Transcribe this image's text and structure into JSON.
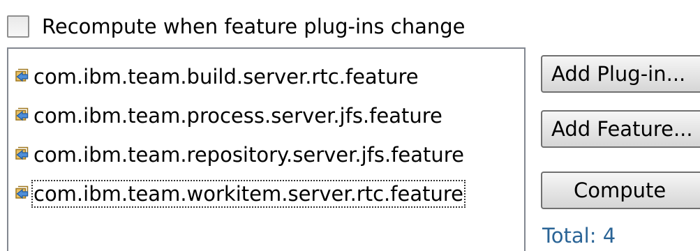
{
  "checkbox": {
    "label": "Recompute when feature plug-ins change",
    "checked": false
  },
  "features": {
    "icon": "feature-plugin-icon",
    "items": [
      {
        "label": "com.ibm.team.build.server.rtc.feature"
      },
      {
        "label": "com.ibm.team.process.server.jfs.feature"
      },
      {
        "label": "com.ibm.team.repository.server.jfs.feature"
      },
      {
        "label": "com.ibm.team.workitem.server.rtc.feature"
      }
    ]
  },
  "buttons": {
    "add_plugin": "Add Plug-in...",
    "add_feature": "Add Feature...",
    "compute": "Compute"
  },
  "total": {
    "label": "Total: 4"
  },
  "colors": {
    "total_text": "#2a6496",
    "list_border": "#828790"
  }
}
